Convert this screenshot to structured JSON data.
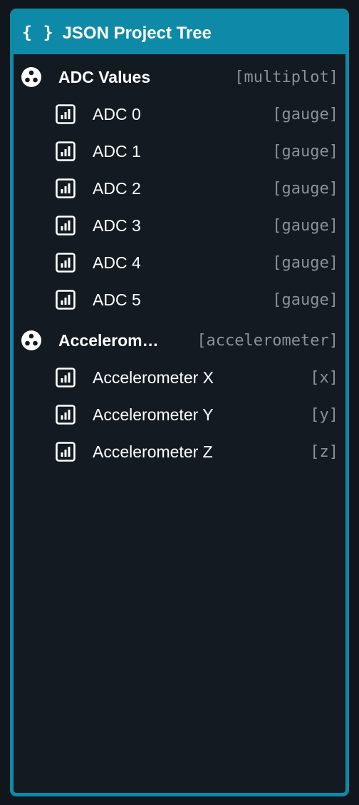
{
  "panel": {
    "icon": "braces-icon",
    "icon_glyph": "{}",
    "title": "JSON Project Tree",
    "accent": "#0e8aa8"
  },
  "tree": [
    {
      "kind": "group",
      "icon": "multiplot-group-icon",
      "label": "ADC Values",
      "tag": "[multiplot]",
      "children": [
        {
          "icon": "gauge-chart-icon",
          "label": "ADC 0",
          "tag": "[gauge]"
        },
        {
          "icon": "gauge-chart-icon",
          "label": "ADC 1",
          "tag": "[gauge]"
        },
        {
          "icon": "gauge-chart-icon",
          "label": "ADC 2",
          "tag": "[gauge]"
        },
        {
          "icon": "gauge-chart-icon",
          "label": "ADC 3",
          "tag": "[gauge]"
        },
        {
          "icon": "gauge-chart-icon",
          "label": "ADC 4",
          "tag": "[gauge]"
        },
        {
          "icon": "gauge-chart-icon",
          "label": "ADC 5",
          "tag": "[gauge]"
        }
      ]
    },
    {
      "kind": "group",
      "icon": "accelerometer-group-icon",
      "label": "Accelerom…",
      "tag": "[accelerometer]",
      "children": [
        {
          "icon": "chart-icon",
          "label": "Accelerometer X",
          "tag": "[x]"
        },
        {
          "icon": "chart-icon",
          "label": "Accelerometer Y",
          "tag": "[y]"
        },
        {
          "icon": "chart-icon",
          "label": "Accelerometer Z",
          "tag": "[z]"
        }
      ]
    }
  ]
}
